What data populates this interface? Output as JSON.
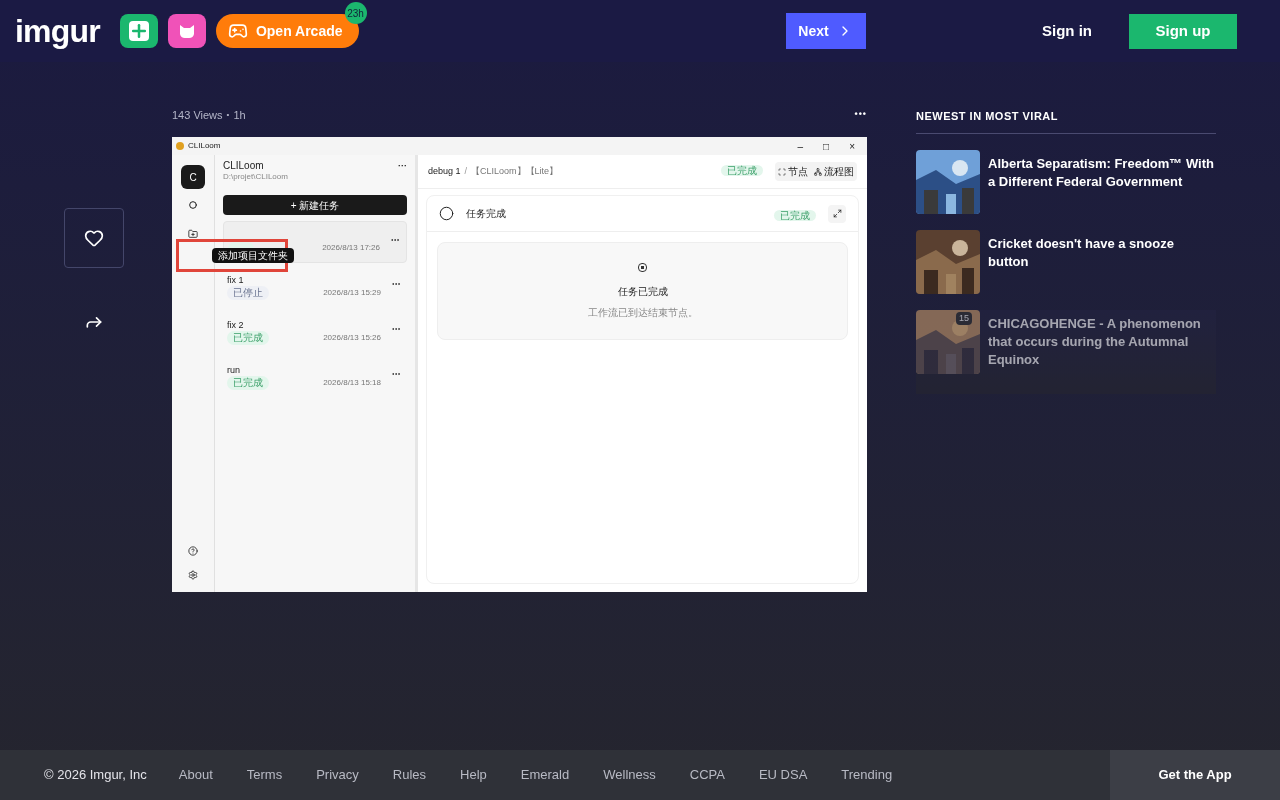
{
  "header": {
    "logo": "imgur",
    "arcade": {
      "label": "Open Arcade",
      "badge": "23h"
    },
    "next": "Next",
    "sign_in": "Sign in",
    "sign_up": "Sign up"
  },
  "post": {
    "meta": [
      "143 Views",
      "•",
      "1h"
    ],
    "more": "•••",
    "app": {
      "title": "CLILoom",
      "window_controls": [
        "–",
        "□",
        "×"
      ],
      "rail": {
        "avatar": "C",
        "tooltip": "添加项目文件夹"
      },
      "project": {
        "name": "CLILoom",
        "path": "D:\\projet\\CLILoom",
        "more": "···"
      },
      "new_task": "+ 新建任务",
      "tasks": [
        {
          "kind": "done",
          "date": "2026/8/13 17:26",
          "selected": true
        },
        {
          "title": "fix 1",
          "kind": "stopped",
          "status_label": "已停止",
          "date": "2026/8/13 15:29",
          "selected": false
        },
        {
          "title": "fix 2",
          "kind": "done",
          "status_label": "已完成",
          "date": "2026/8/13 15:26",
          "selected": false
        },
        {
          "title": "run",
          "kind": "done",
          "status_label": "已完成",
          "date": "2026/8/13 15:18",
          "selected": false
        }
      ],
      "breadcrumb": [
        "debug 1",
        "/",
        "【CLILoom】【Lite】"
      ],
      "top_status": "已完成",
      "view_buttons": [
        "节点",
        "流程图"
      ],
      "node": {
        "title": "任务完成",
        "status": "已完成",
        "card_title": "任务已完成",
        "card_text": "工作流已到达结束节点。"
      }
    }
  },
  "sidebar": {
    "heading": "NEWEST IN MOST VIRAL",
    "items": [
      {
        "title": "Alberta Separatism: Freedom™ With a Different Federal Government",
        "kind": "picture",
        "faded": false
      },
      {
        "title": "Cricket doesn't have a snooze button",
        "kind": "picture",
        "faded": false
      },
      {
        "title": "CHICAGOHENGE - A phenomenon that occurs during the Autumnal Equinox",
        "kind": "picture",
        "count": "15",
        "faded": true
      }
    ]
  },
  "footer": {
    "links": [
      "© 2026 Imgur, Inc",
      "About",
      "Terms",
      "Privacy",
      "Rules",
      "Help",
      "Emerald",
      "Wellness",
      "CCPA",
      "EU DSA",
      "Trending"
    ],
    "app": "Get the App"
  }
}
